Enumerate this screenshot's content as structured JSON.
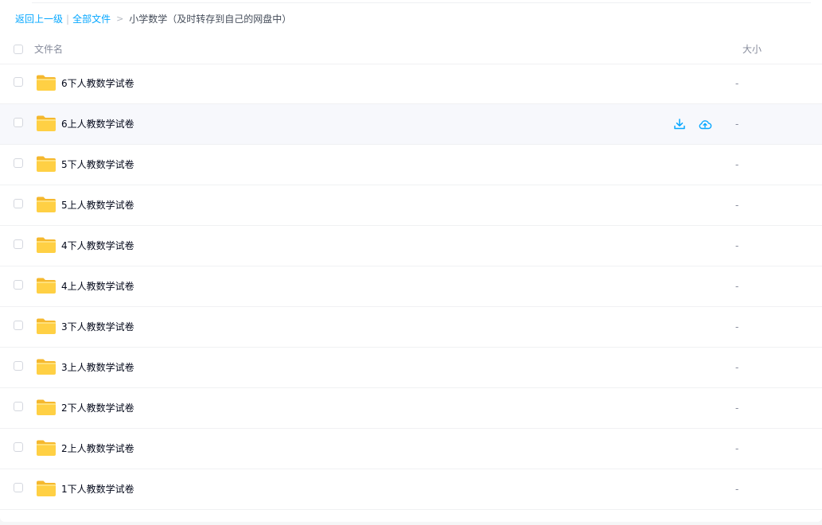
{
  "breadcrumb": {
    "back": "返回上一级",
    "separator": "|",
    "all_files": "全部文件",
    "arrow": ">",
    "current": "小学数学（及时转存到自己的网盘中）"
  },
  "table": {
    "header_name": "文件名",
    "header_size": "大小",
    "rows": [
      {
        "name": "6下人教数学试卷",
        "size": "-"
      },
      {
        "name": "6上人教数学试卷",
        "size": "-"
      },
      {
        "name": "5下人教数学试卷",
        "size": "-"
      },
      {
        "name": "5上人教数学试卷",
        "size": "-"
      },
      {
        "name": "4下人教数学试卷",
        "size": "-"
      },
      {
        "name": "4上人教数学试卷",
        "size": "-"
      },
      {
        "name": "3下人教数学试卷",
        "size": "-"
      },
      {
        "name": "3上人教数学试卷",
        "size": "-"
      },
      {
        "name": "2下人教数学试卷",
        "size": "-"
      },
      {
        "name": "2上人教数学试卷",
        "size": "-"
      },
      {
        "name": "1下人教数学试卷",
        "size": "-"
      }
    ]
  },
  "icons": {
    "folder": "folder-icon",
    "download": "download-icon",
    "save_to_cloud": "cloud-upload-icon"
  },
  "colors": {
    "link": "#06a7ff",
    "hover_row": "#f7f8fc",
    "folder_yellow": "#ffd044",
    "text": "#03081a",
    "muted": "#878c9c"
  }
}
